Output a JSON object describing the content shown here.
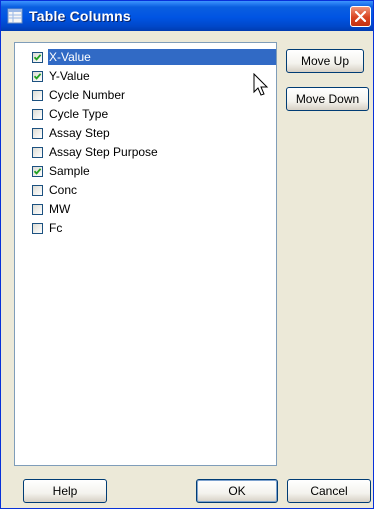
{
  "window": {
    "title": "Table Columns"
  },
  "columns": [
    {
      "label": "X-Value",
      "checked": true,
      "selected": true
    },
    {
      "label": "Y-Value",
      "checked": true,
      "selected": false
    },
    {
      "label": "Cycle Number",
      "checked": false,
      "selected": false
    },
    {
      "label": "Cycle Type",
      "checked": false,
      "selected": false
    },
    {
      "label": "Assay Step",
      "checked": false,
      "selected": false
    },
    {
      "label": "Assay Step Purpose",
      "checked": false,
      "selected": false
    },
    {
      "label": "Sample",
      "checked": true,
      "selected": false
    },
    {
      "label": "Conc",
      "checked": false,
      "selected": false
    },
    {
      "label": "MW",
      "checked": false,
      "selected": false
    },
    {
      "label": "Fc",
      "checked": false,
      "selected": false
    }
  ],
  "buttons": {
    "move_up": "Move Up",
    "move_down": "Move Down",
    "help": "Help",
    "ok": "OK",
    "cancel": "Cancel"
  },
  "icons": {
    "title": "table-icon",
    "close": "close-icon",
    "check": "checkmark-icon",
    "cursor": "mouse-pointer-icon"
  },
  "colors": {
    "titlebar": "#0054e3",
    "selection": "#316ac5",
    "close": "#d94421",
    "check": "#21a121"
  }
}
